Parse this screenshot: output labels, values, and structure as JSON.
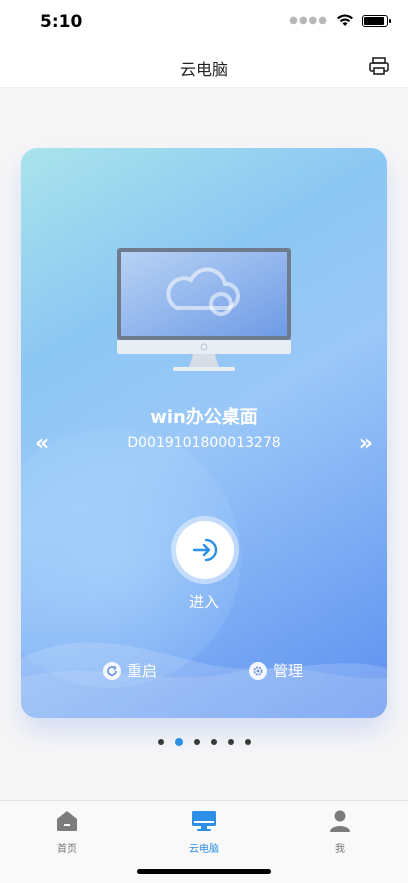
{
  "status_bar": {
    "time": "5:10"
  },
  "nav": {
    "title": "云电脑",
    "right_icon": "printer-icon"
  },
  "card": {
    "title": "win办公桌面",
    "device_id": "D0019101800013278",
    "enter_label": "进入",
    "restart_label": "重启",
    "manage_label": "管理"
  },
  "pager": {
    "count": 6,
    "active_index": 1
  },
  "tabbar": {
    "items": [
      {
        "label": "首页",
        "icon": "home-icon"
      },
      {
        "label": "云电脑",
        "icon": "computer-icon"
      },
      {
        "label": "我",
        "icon": "person-icon"
      }
    ],
    "active": 1
  },
  "colors": {
    "accent": "#2e8fe6",
    "card_gradient_start": "#a9e4ec",
    "card_gradient_end": "#5c8ff0"
  }
}
